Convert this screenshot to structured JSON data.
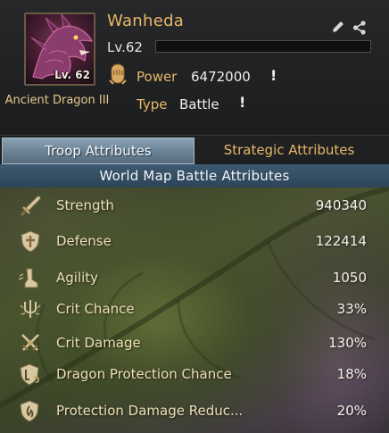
{
  "dragon": {
    "portrait_level": "Lv. 62",
    "name": "Ancient Dragon III"
  },
  "commander": {
    "name": "Wanheda",
    "level_label": "Lv.62",
    "level_progress": 0.0
  },
  "stats": {
    "power_label": "Power",
    "power_value": "6472000",
    "type_label": "Type",
    "type_value": "Battle",
    "info_mark": "!"
  },
  "tabs": [
    {
      "label": "Troop Attributes",
      "active": true
    },
    {
      "label": "Strategic Attributes",
      "active": false
    }
  ],
  "section_title": "World Map Battle Attributes",
  "attributes": [
    {
      "label": "Strength",
      "value": "940340",
      "icon": "sword-icon"
    },
    {
      "label": "Defense",
      "value": "122414",
      "icon": "shield-cross-icon"
    },
    {
      "label": "Agility",
      "value": "1050",
      "icon": "boot-icon"
    },
    {
      "label": "Crit Chance",
      "value": "33%",
      "icon": "crit-trident-icon"
    },
    {
      "label": "Crit Damage",
      "value": "130%",
      "icon": "crossed-swords-icon"
    },
    {
      "label": "Dragon Protection Chance",
      "value": "18%",
      "icon": "dragon-shield-icon"
    },
    {
      "label": "Protection Damage Reduc...",
      "value": "20%",
      "icon": "shield-fire-icon"
    }
  ],
  "colors": {
    "gold_text": "#e8b868",
    "active_tab": "#6c8496",
    "section_header": "#2c4458"
  }
}
